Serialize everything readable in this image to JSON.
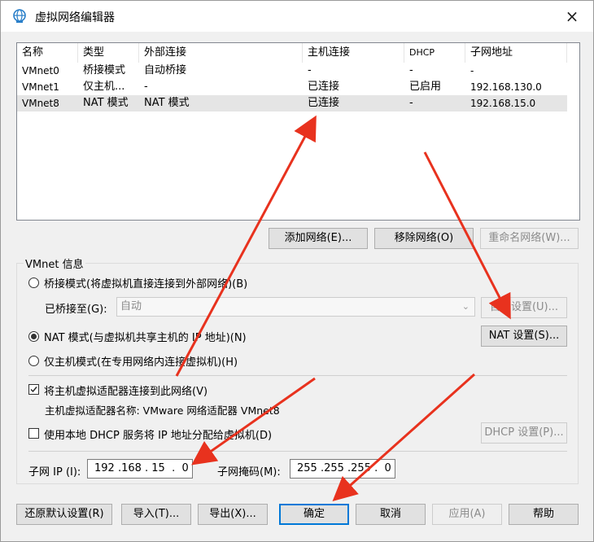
{
  "window": {
    "title": "虚拟网络编辑器",
    "close_icon": "×"
  },
  "network_list": {
    "columns": [
      "名称",
      "类型",
      "外部连接",
      "主机连接",
      "DHCP",
      "子网地址"
    ],
    "rows": [
      {
        "name": "VMnet0",
        "type": "桥接模式",
        "external": "自动桥接",
        "host": "-",
        "dhcp": "-",
        "subnet": "-"
      },
      {
        "name": "VMnet1",
        "type": "仅主机...",
        "external": "-",
        "host": "已连接",
        "dhcp": "已启用",
        "subnet": "192.168.130.0"
      },
      {
        "name": "VMnet8",
        "type": "NAT 模式",
        "external": "NAT 模式",
        "host": "已连接",
        "dhcp": "-",
        "subnet": "192.168.15.0"
      }
    ],
    "selected_row": 2
  },
  "list_buttons": {
    "add": "添加网络(E)...",
    "remove": "移除网络(O)",
    "rename": "重命名网络(W)..."
  },
  "vmnet_info": {
    "group_title": "VMnet 信息",
    "bridged_label": "桥接模式(将虚拟机直接连接到外部网络)(B)",
    "bridged_to_label": "已桥接至(G):",
    "bridged_to_value": "自动",
    "auto_settings": "自动设置(U)...",
    "nat_label": "NAT 模式(与虚拟机共享主机的 IP 地址)(N)",
    "nat_settings": "NAT 设置(S)...",
    "hostonly_label": "仅主机模式(在专用网络内连接虚拟机)(H)",
    "connect_adapter_label": "将主机虚拟适配器连接到此网络(V)",
    "adapter_name_text": "主机虚拟适配器名称: VMware 网络适配器 VMnet8",
    "dhcp_label": "使用本地 DHCP 服务将 IP 地址分配给虚拟机(D)",
    "dhcp_settings": "DHCP 设置(P)...",
    "subnet_ip_label": "子网 IP (I):",
    "subnet_ip_value": "192 .168 . 15  .  0",
    "subnet_mask_label": "子网掩码(M):",
    "subnet_mask_value": "255 .255 .255 .  0",
    "selected_mode": "nat",
    "connect_adapter_checked": true,
    "dhcp_checked": false
  },
  "footer_buttons": {
    "restore": "还原默认设置(R)",
    "import": "导入(T)...",
    "export": "导出(X)...",
    "ok": "确定",
    "cancel": "取消",
    "apply": "应用(A)",
    "help": "帮助"
  },
  "colors": {
    "annotation_arrow": "#e8321e",
    "accent": "#0078d7"
  }
}
